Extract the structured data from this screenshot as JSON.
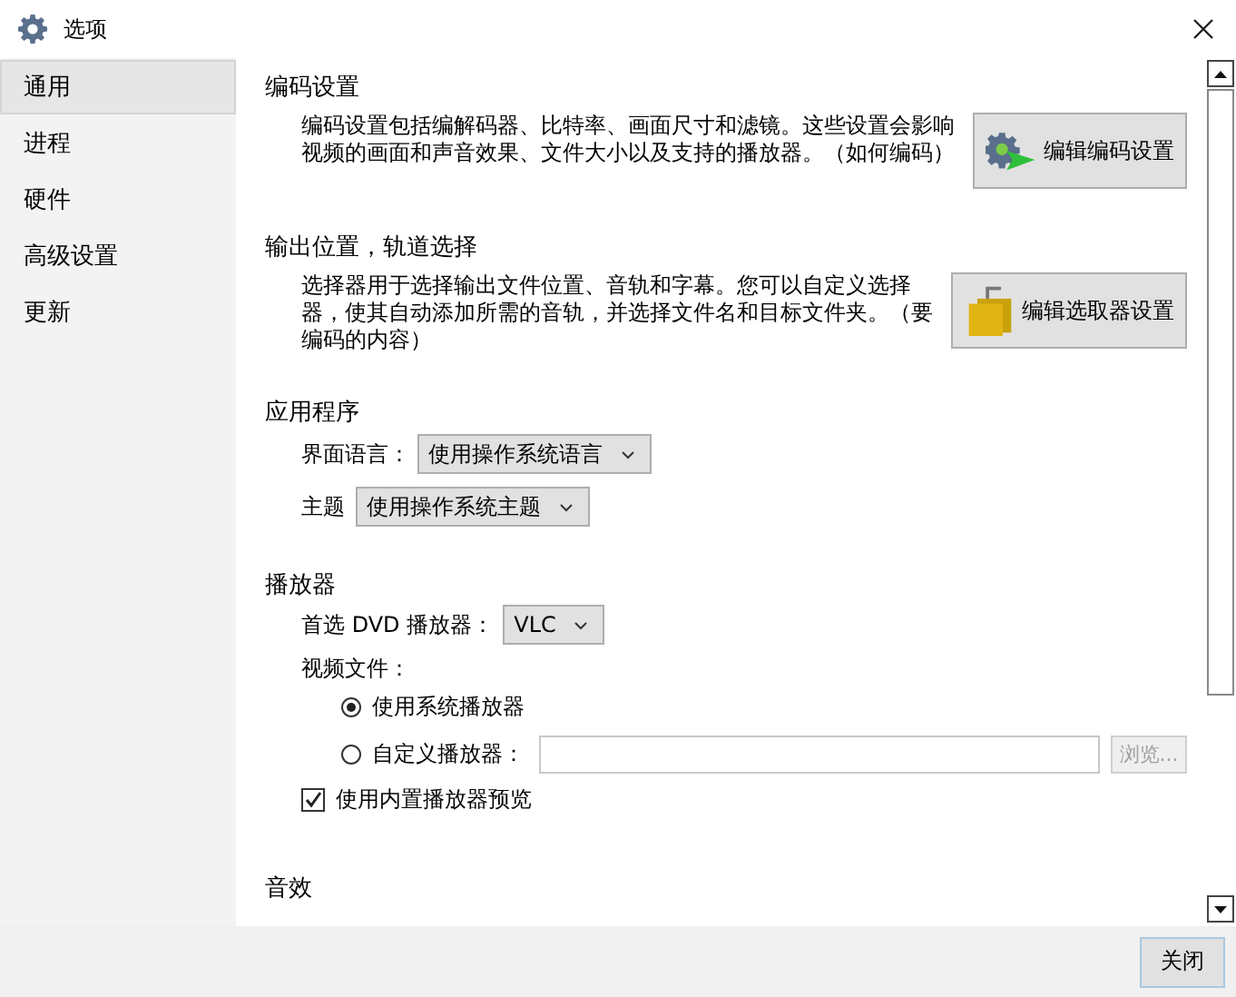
{
  "window": {
    "title": "选项"
  },
  "sidebar": {
    "items": [
      {
        "label": "通用",
        "selected": true
      },
      {
        "label": "进程",
        "selected": false
      },
      {
        "label": "硬件",
        "selected": false
      },
      {
        "label": "高级设置",
        "selected": false
      },
      {
        "label": "更新",
        "selected": false
      }
    ]
  },
  "encoding": {
    "title": "编码设置",
    "text": "编码设置包括编解码器、比特率、画面尺寸和滤镜。这些设置会影响视频的画面和声音效果、文件大小以及支持的播放器。（如何编码）",
    "button": "编辑编码设置"
  },
  "output": {
    "title": "输出位置，轨道选择",
    "text": "选择器用于选择输出文件位置、音轨和字幕。您可以自定义选择器，使其自动添加所需的音轨，并选择文件名和目标文件夹。（要编码的内容）",
    "button": "编辑选取器设置"
  },
  "application": {
    "title": "应用程序",
    "fields": [
      {
        "label": "界面语言：",
        "value": "使用操作系统语言"
      },
      {
        "label": "主题",
        "value": "使用操作系统主题"
      }
    ]
  },
  "player": {
    "title": "播放器",
    "dvd": {
      "label": "首选 DVD 播放器：",
      "value": "VLC"
    },
    "video_label": "视频文件：",
    "options": [
      {
        "label": "使用系统播放器",
        "selected": true
      },
      {
        "label": "自定义播放器：",
        "selected": false
      }
    ],
    "browse": {
      "label": "浏览...",
      "disabled": true
    },
    "preview": {
      "label": "使用内置播放器预览",
      "checked": true
    }
  },
  "audio": {
    "title": "音效"
  },
  "footer": {
    "close_button": "关闭"
  }
}
